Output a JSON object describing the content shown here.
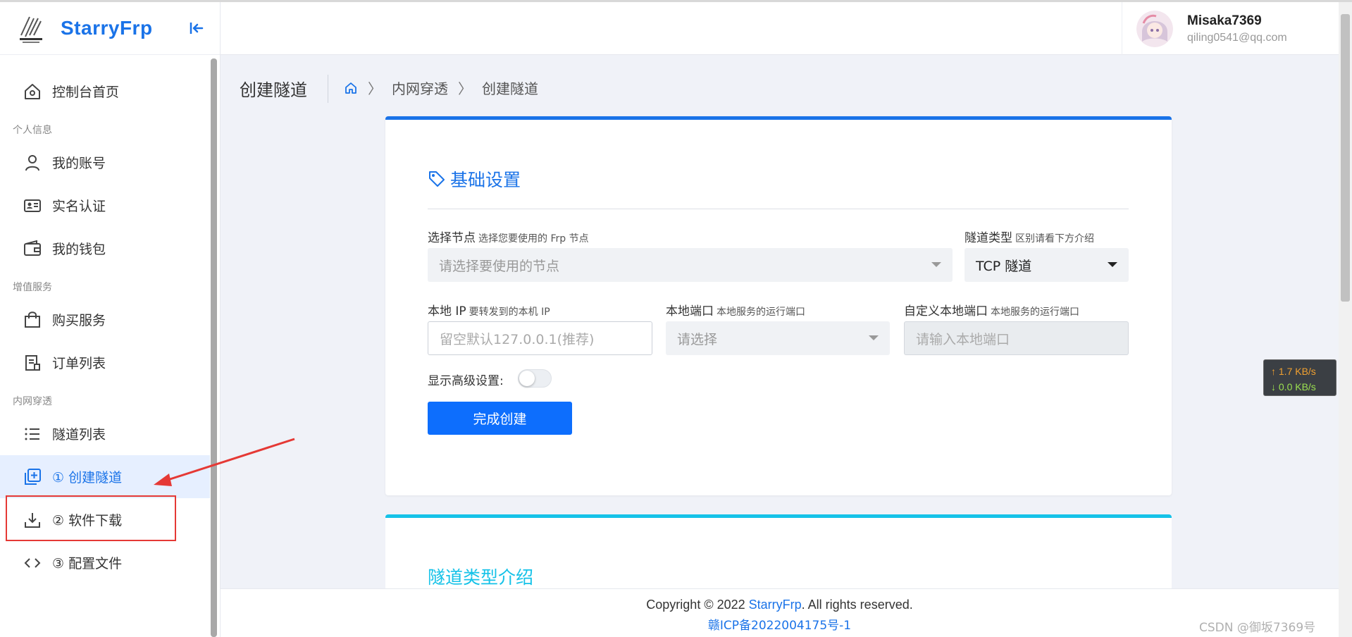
{
  "brand": {
    "name": "StarryFrp",
    "logo_text": "StarryFrp"
  },
  "header": {
    "user_name": "Misaka7369",
    "user_email": "qiling0541@qq.com"
  },
  "sidebar": {
    "home": "控制台首页",
    "sections": {
      "personal": "个人信息",
      "value_added": "增值服务",
      "intranet": "内网穿透"
    },
    "items": {
      "account": "我的账号",
      "realname": "实名认证",
      "wallet": "我的钱包",
      "buy": "购买服务",
      "orders": "订单列表",
      "tunnels": "隧道列表",
      "create": "① 创建隧道",
      "download": "② 软件下载",
      "config": "③ 配置文件"
    }
  },
  "breadcrumb": {
    "title": "创建隧道",
    "level1": "内网穿透",
    "level2": "创建隧道"
  },
  "form": {
    "section_title": "基础设置",
    "node_label": "选择节点",
    "node_hint": "选择您要使用的 Frp 节点",
    "node_placeholder": "请选择要使用的节点",
    "type_label": "隧道类型",
    "type_hint": "区别请看下方介绍",
    "type_value": "TCP 隧道",
    "local_ip_label": "本地 IP",
    "local_ip_hint": "要转发到的本机 IP",
    "local_ip_placeholder": "留空默认127.0.0.1(推荐)",
    "local_port_label": "本地端口",
    "local_port_hint": "本地服务的运行端口",
    "local_port_placeholder": "请选择",
    "custom_port_label": "自定义本地端口",
    "custom_port_hint": "本地服务的运行端口",
    "custom_port_placeholder": "请输入本地端口",
    "advanced_label": "显示高级设置:",
    "advanced_enabled": false,
    "submit_label": "完成创建"
  },
  "card2": {
    "title": "隧道类型介绍"
  },
  "footer": {
    "copyright_prefix": "Copyright © 2022 ",
    "copyright_link": "StarryFrp",
    "copyright_suffix": ". All rights reserved.",
    "icp": "赣ICP备2022004175号-1"
  },
  "speed_widget": {
    "up": "↑ 1.7 KB/s",
    "down": "↓ 0.0 KB/s"
  },
  "watermark": "CSDN @御坂7369号",
  "colors": {
    "accent": "#1a73e8",
    "button": "#0d6efd",
    "card2_accent": "#15c2e8",
    "annotation": "#e53935"
  }
}
